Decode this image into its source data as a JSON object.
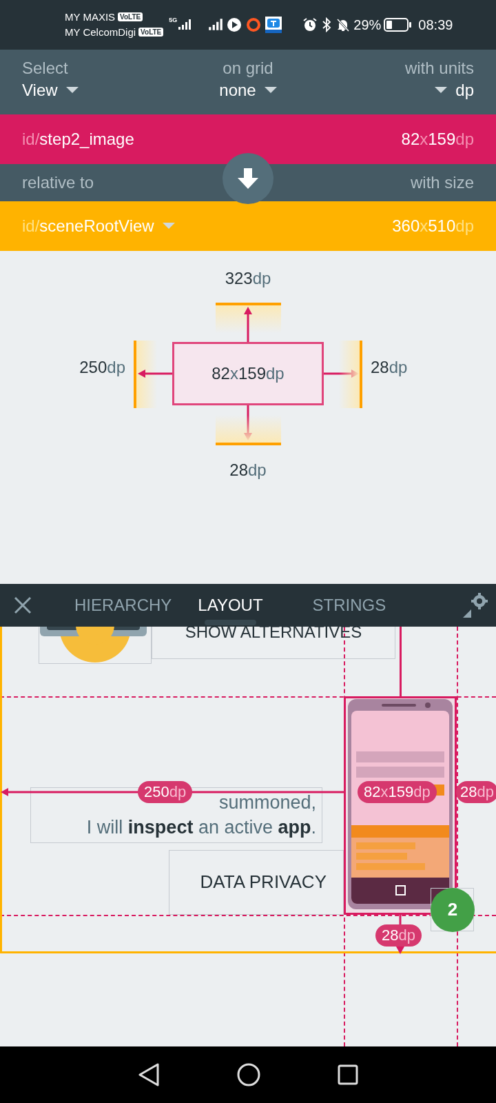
{
  "status_bar": {
    "carriers": [
      {
        "name": "MY MAXIS",
        "badge": "VoLTE"
      },
      {
        "name": "MY CelcomDigi",
        "badge": "VoLTE"
      }
    ],
    "network": "5G",
    "battery_text": "29%",
    "time": "08:39"
  },
  "selector": [
    {
      "label": "Select",
      "value": "View",
      "kind": "caret_after"
    },
    {
      "label": "on grid",
      "value": "none",
      "kind": "caret_after"
    },
    {
      "label": "with units",
      "value": "dp",
      "kind": "caret_before"
    }
  ],
  "target": {
    "prefix": "id/",
    "id": "step2_image",
    "size": "82x159dp"
  },
  "relation": {
    "left": "relative to",
    "right": "with size"
  },
  "parent": {
    "prefix": "id/",
    "id": "sceneRootView",
    "size": "360x510dp"
  },
  "diagram": {
    "size": "82x159dp",
    "top": "323dp",
    "left": "250dp",
    "right": "28dp",
    "bottom": "28dp"
  },
  "tabs": [
    {
      "label": "HIERARCHY",
      "selected": false
    },
    {
      "label": "LAYOUT",
      "selected": true
    },
    {
      "label": "STRINGS",
      "selected": false
    }
  ],
  "canvas": {
    "alternatives_label": "SHOW ALTERNATIVES",
    "message": [
      "summoned,",
      "I will **inspect** an active **app**."
    ],
    "privacy_label": "DATA PRIVACY",
    "step_badge": "2",
    "badges": {
      "left": "250dp",
      "size": "82x159dp",
      "right": "28dp",
      "bottom": "28dp"
    }
  }
}
